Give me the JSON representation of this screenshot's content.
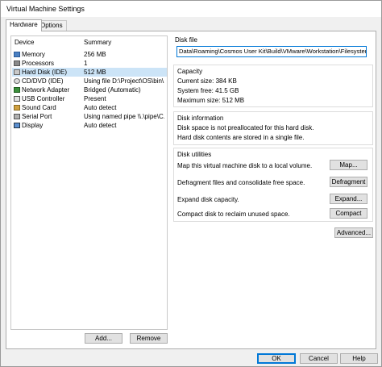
{
  "window": {
    "title": "Virtual Machine Settings"
  },
  "tabs": [
    {
      "label": "Hardware"
    },
    {
      "label": "Options"
    }
  ],
  "devices": {
    "header": {
      "device": "Device",
      "summary": "Summary"
    },
    "rows": [
      {
        "name": "Memory",
        "summary": "256 MB",
        "icon": "memory-icon"
      },
      {
        "name": "Processors",
        "summary": "1",
        "icon": "processor-icon"
      },
      {
        "name": "Hard Disk (IDE)",
        "summary": "512 MB",
        "icon": "hard-disk-icon",
        "selected": true
      },
      {
        "name": "CD/DVD (IDE)",
        "summary": "Using file D:\\Project\\OS\\bin\\...",
        "icon": "cd-dvd-icon"
      },
      {
        "name": "Network Adapter",
        "summary": "Bridged (Automatic)",
        "icon": "network-adapter-icon"
      },
      {
        "name": "USB Controller",
        "summary": "Present",
        "icon": "usb-controller-icon"
      },
      {
        "name": "Sound Card",
        "summary": "Auto detect",
        "icon": "sound-card-icon"
      },
      {
        "name": "Serial Port",
        "summary": "Using named pipe \\\\.\\pipe\\C...",
        "icon": "serial-port-icon"
      },
      {
        "name": "Display",
        "summary": "Auto detect",
        "icon": "display-icon"
      }
    ],
    "add_label": "Add...",
    "remove_label": "Remove"
  },
  "disk_file": {
    "label": "Disk file",
    "path": "Data\\Roaming\\Cosmos User Kit\\Build\\VMware\\Workstation\\Filesystem.vmdk"
  },
  "capacity": {
    "label": "Capacity",
    "current_size": "Current size: 384 KB",
    "system_free": "System free: 41.5 GB",
    "maximum_size": "Maximum size: 512 MB"
  },
  "disk_information": {
    "label": "Disk information",
    "line1": "Disk space is not preallocated for this hard disk.",
    "line2": "Hard disk contents are stored in a single file."
  },
  "disk_utilities": {
    "label": "Disk utilities",
    "map_text": "Map this virtual machine disk to a local volume.",
    "map_label": "Map...",
    "defrag_text": "Defragment files and consolidate free space.",
    "defrag_label": "Defragment",
    "expand_text": "Expand disk capacity.",
    "expand_label": "Expand...",
    "compact_text": "Compact disk to reclaim unused space.",
    "compact_label": "Compact"
  },
  "advanced_label": "Advanced...",
  "footer": {
    "ok_label": "OK",
    "cancel_label": "Cancel",
    "help_label": "Help"
  }
}
